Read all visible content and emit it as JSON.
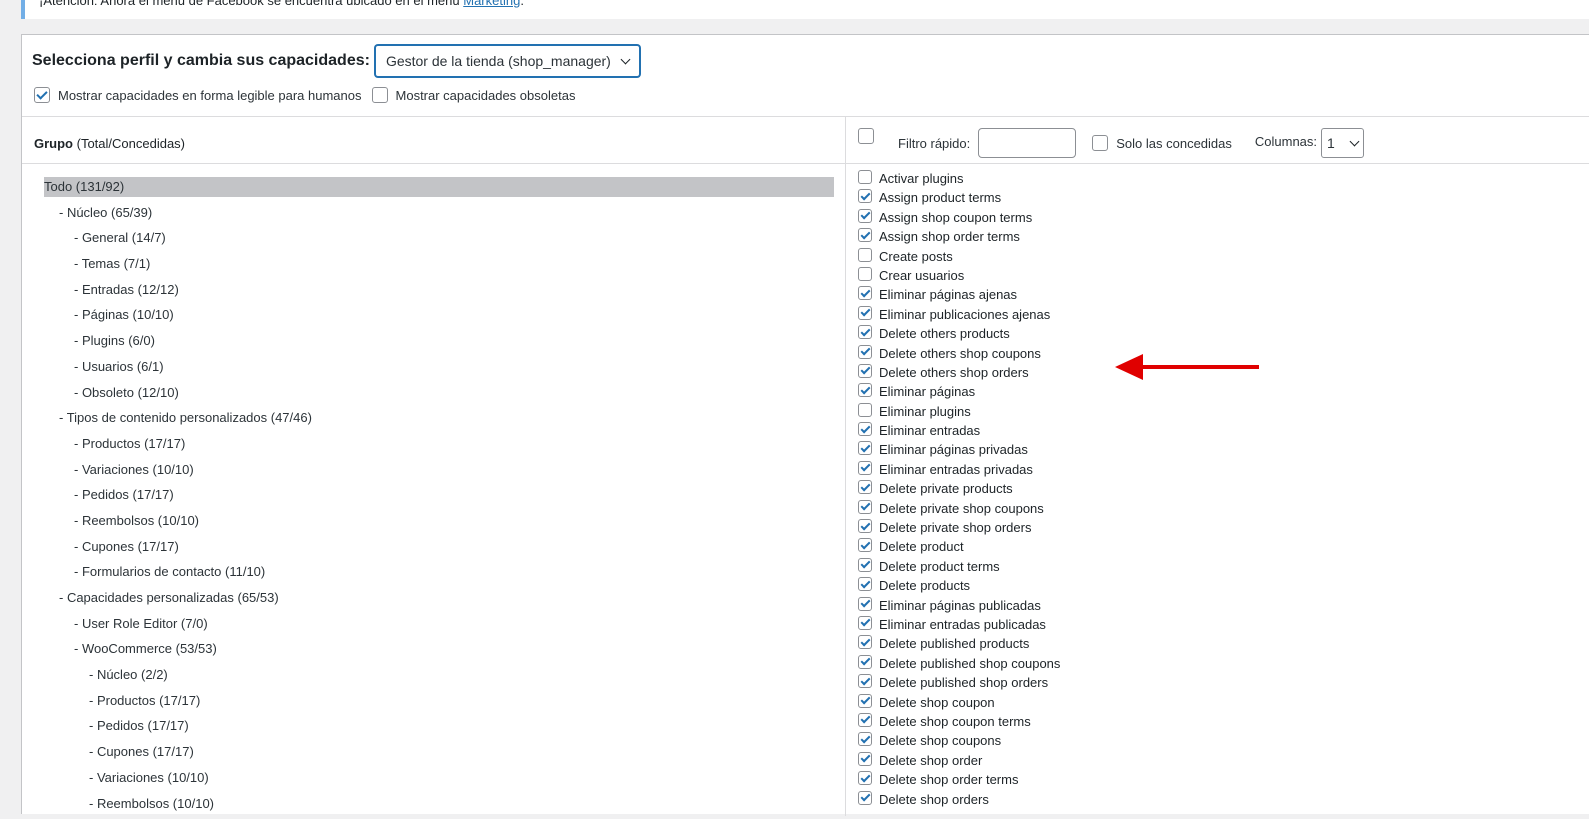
{
  "notice": {
    "text": "¡Atención: Ahora el menú de Facebook se encuentra ubicado en el menú",
    "link": "Marketing",
    "suffix": "."
  },
  "role_selector": {
    "label": "Selecciona perfil y cambia sus capacidades:",
    "selected": "Gestor de la tienda (shop_manager)"
  },
  "options": {
    "human_readable": {
      "label": "Mostrar capacidades en forma legible para humanos",
      "checked": true
    },
    "deprecated": {
      "label": "Mostrar capacidades obsoletas",
      "checked": false
    }
  },
  "group_header": {
    "bold": "Grupo",
    "rest": " (Total/Concedidas)"
  },
  "caps_header": {
    "quick_filter_label": "Filtro rápido:",
    "quick_filter_value": "",
    "granted_only_label": "Solo las concedidas",
    "columns_label": "Columnas:",
    "columns_value": "1"
  },
  "groups": [
    {
      "label": "Todo (131/92)",
      "level": 0,
      "selected": true
    },
    {
      "label": "- Núcleo (65/39)",
      "level": 1
    },
    {
      "label": "- General (14/7)",
      "level": 2
    },
    {
      "label": "- Temas (7/1)",
      "level": 2
    },
    {
      "label": "- Entradas (12/12)",
      "level": 2
    },
    {
      "label": "- Páginas (10/10)",
      "level": 2
    },
    {
      "label": "- Plugins (6/0)",
      "level": 2
    },
    {
      "label": "- Usuarios (6/1)",
      "level": 2
    },
    {
      "label": "- Obsoleto (12/10)",
      "level": 2
    },
    {
      "label": "- Tipos de contenido personalizados (47/46)",
      "level": 1
    },
    {
      "label": "- Productos (17/17)",
      "level": 2
    },
    {
      "label": "- Variaciones (10/10)",
      "level": 2
    },
    {
      "label": "- Pedidos (17/17)",
      "level": 2
    },
    {
      "label": "- Reembolsos (10/10)",
      "level": 2
    },
    {
      "label": "- Cupones (17/17)",
      "level": 2
    },
    {
      "label": "- Formularios de contacto (11/10)",
      "level": 2
    },
    {
      "label": "- Capacidades personalizadas (65/53)",
      "level": 1
    },
    {
      "label": "- User Role Editor (7/0)",
      "level": 2
    },
    {
      "label": "- WooCommerce (53/53)",
      "level": 2
    },
    {
      "label": "- Núcleo (2/2)",
      "level": 3
    },
    {
      "label": "- Productos (17/17)",
      "level": 3
    },
    {
      "label": "- Pedidos (17/17)",
      "level": 3
    },
    {
      "label": "- Cupones (17/17)",
      "level": 3
    },
    {
      "label": "- Variaciones (10/10)",
      "level": 3
    },
    {
      "label": "- Reembolsos (10/10)",
      "level": 3
    }
  ],
  "capabilities": [
    {
      "label": "Activar plugins",
      "checked": false
    },
    {
      "label": "Assign product terms",
      "checked": true
    },
    {
      "label": "Assign shop coupon terms",
      "checked": true
    },
    {
      "label": "Assign shop order terms",
      "checked": true
    },
    {
      "label": "Create posts",
      "checked": false
    },
    {
      "label": "Crear usuarios",
      "checked": false
    },
    {
      "label": "Eliminar páginas ajenas",
      "checked": true
    },
    {
      "label": "Eliminar publicaciones ajenas",
      "checked": true
    },
    {
      "label": "Delete others products",
      "checked": true
    },
    {
      "label": "Delete others shop coupons",
      "checked": true
    },
    {
      "label": "Delete others shop orders",
      "checked": true
    },
    {
      "label": "Eliminar páginas",
      "checked": true
    },
    {
      "label": "Eliminar plugins",
      "checked": false
    },
    {
      "label": "Eliminar entradas",
      "checked": true
    },
    {
      "label": "Eliminar páginas privadas",
      "checked": true
    },
    {
      "label": "Eliminar entradas privadas",
      "checked": true
    },
    {
      "label": "Delete private products",
      "checked": true
    },
    {
      "label": "Delete private shop coupons",
      "checked": true
    },
    {
      "label": "Delete private shop orders",
      "checked": true
    },
    {
      "label": "Delete product",
      "checked": true
    },
    {
      "label": "Delete product terms",
      "checked": true
    },
    {
      "label": "Delete products",
      "checked": true
    },
    {
      "label": "Eliminar páginas publicadas",
      "checked": true
    },
    {
      "label": "Eliminar entradas publicadas",
      "checked": true
    },
    {
      "label": "Delete published products",
      "checked": true
    },
    {
      "label": "Delete published shop coupons",
      "checked": true
    },
    {
      "label": "Delete published shop orders",
      "checked": true
    },
    {
      "label": "Delete shop coupon",
      "checked": true
    },
    {
      "label": "Delete shop coupon terms",
      "checked": true
    },
    {
      "label": "Delete shop coupons",
      "checked": true
    },
    {
      "label": "Delete shop order",
      "checked": true
    },
    {
      "label": "Delete shop order terms",
      "checked": true
    },
    {
      "label": "Delete shop orders",
      "checked": true
    }
  ],
  "colors": {
    "accent": "#2271b1",
    "annotation_arrow": "#e00000",
    "selected_row": "#c3c4c7"
  },
  "icons": {
    "select_arrow": "chevron-down-icon",
    "annotation": "arrow-left-icon"
  }
}
